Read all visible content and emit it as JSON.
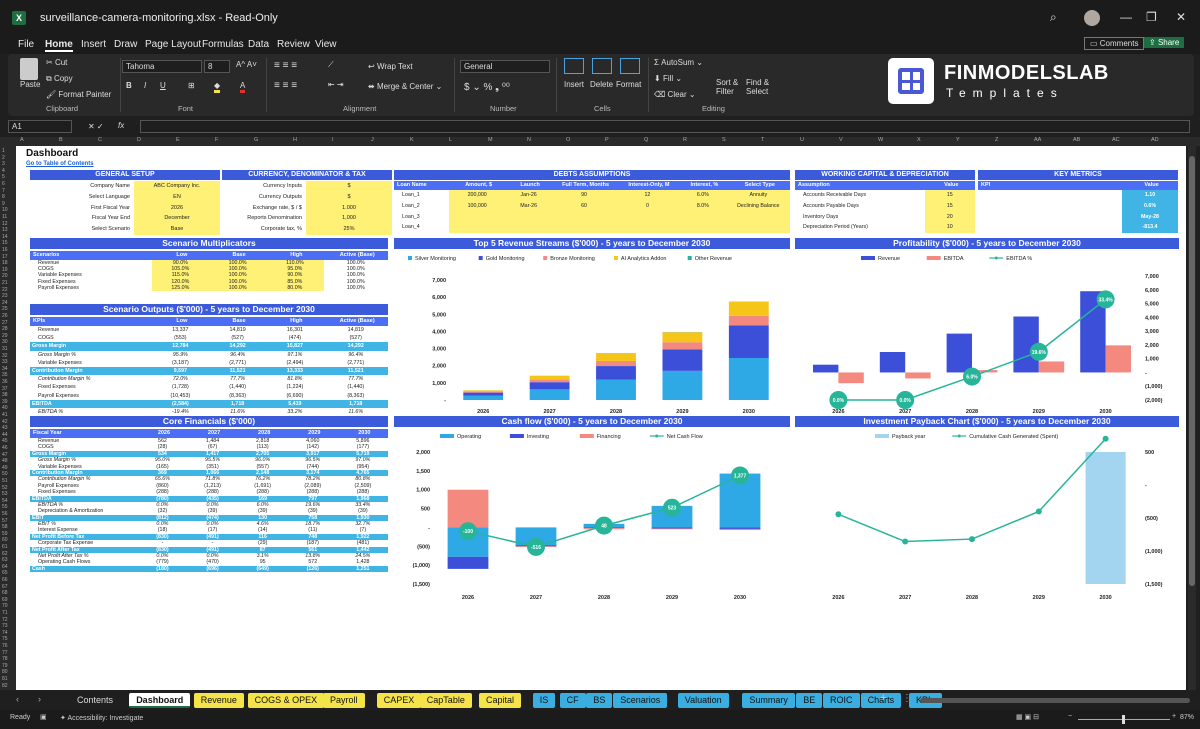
{
  "window": {
    "filename": "surveillance-camera-monitoring.xlsx",
    "mode": "Read-Only"
  },
  "menu": [
    "File",
    "Home",
    "Insert",
    "Draw",
    "Page Layout",
    "Formulas",
    "Data",
    "Review",
    "View"
  ],
  "topright": {
    "comments": "Comments",
    "share": "Share"
  },
  "ribbon": {
    "clipboard": {
      "paste": "Paste",
      "cut": "Cut",
      "copy": "Copy",
      "format_painter": "Format Painter",
      "label": "Clipboard"
    },
    "font": {
      "name": "Tahoma",
      "size": "8",
      "label": "Font"
    },
    "alignment": {
      "wrap": "Wrap Text",
      "merge": "Merge & Center",
      "label": "Alignment"
    },
    "number": {
      "format": "General",
      "label": "Number"
    },
    "cells": {
      "insert": "Insert",
      "delete": "Delete",
      "format": "Format",
      "label": "Cells"
    },
    "editing": {
      "autosum": "AutoSum",
      "fill": "Fill",
      "clear": "Clear",
      "sort": "Sort & Filter",
      "find": "Find & Select",
      "label": "Editing"
    },
    "logo": {
      "title": "FINMODELSLAB",
      "sub": "Templates"
    }
  },
  "formula_bar": {
    "cell": "A1",
    "fx": "fx"
  },
  "dashboard": {
    "title": "Dashboard",
    "toc": "Go to Table of Contents",
    "general": {
      "header": "GENERAL SETUP",
      "rows": [
        [
          "Company Name",
          "ABC Company Inc."
        ],
        [
          "Select Language",
          "EN"
        ],
        [
          "First Fiscal Year",
          "2026"
        ],
        [
          "Fiscal Year End",
          "December"
        ],
        [
          "Select Scenario",
          "Base"
        ]
      ]
    },
    "currency": {
      "header": "CURRENCY, DENOMINATOR & TAX",
      "rows": [
        [
          "Currency Inputs",
          "$"
        ],
        [
          "Currency Outputs",
          "$"
        ],
        [
          "Exchange rate, $ / $",
          "1.000"
        ],
        [
          "Reports Denomination",
          "1,000"
        ],
        [
          "Corporate tax, %",
          "25%"
        ]
      ]
    },
    "debts": {
      "header": "DEBTS ASSUMPTIONS",
      "cols": [
        "Loan Name",
        "Amount, $",
        "Launch",
        "Full Term, Months",
        "Interest-Only, M",
        "Interest, %",
        "Select Type"
      ],
      "rows": [
        [
          "Loan_1",
          "200,000",
          "Jan-26",
          "90",
          "12",
          "6.0%",
          "Annuity"
        ],
        [
          "Loan_2",
          "100,000",
          "Mar-26",
          "60",
          "0",
          "8.0%",
          "Declining Balance"
        ],
        [
          "Loan_3",
          "",
          "",
          "",
          "",
          "",
          ""
        ],
        [
          "Loan_4",
          "",
          "",
          "",
          "",
          "",
          ""
        ]
      ]
    },
    "wc": {
      "header": "WORKING CAPITAL & DEPRECIATION",
      "cols": [
        "Assumption",
        "Value"
      ],
      "rows": [
        [
          "Accounts Receivable Days",
          "15"
        ],
        [
          "Accounts Payable Days",
          "15"
        ],
        [
          "Inventory Days",
          "20"
        ],
        [
          "Depreciation Period (Years)",
          "10"
        ]
      ]
    },
    "kpi": {
      "header": "KEY METRICS",
      "cols": [
        "KPI",
        "Value"
      ],
      "rows": [
        [
          "Return on Equity (ROE)",
          "1.10"
        ],
        [
          "Internal Rate of Return (IRR), %",
          "0.6%"
        ],
        [
          "Minimum Cash Month",
          "May-28"
        ],
        [
          "Minimum Cash ($'000)",
          "-813.4"
        ]
      ]
    },
    "scen_mult": {
      "header": "Scenario Multiplicators",
      "cols": [
        "Scenarios",
        "Low",
        "Base",
        "High",
        "Active (Base)"
      ],
      "rows": [
        [
          "Revenue",
          "90.0%",
          "100.0%",
          "110.0%",
          "100.0%"
        ],
        [
          "COGS",
          "105.0%",
          "100.0%",
          "95.0%",
          "100.0%"
        ],
        [
          "Variable Expenses",
          "115.0%",
          "100.0%",
          "90.0%",
          "100.0%"
        ],
        [
          "Fixed Expenses",
          "120.0%",
          "100.0%",
          "85.0%",
          "100.0%"
        ],
        [
          "Payroll Expenses",
          "125.0%",
          "100.0%",
          "80.0%",
          "100.0%"
        ]
      ]
    },
    "scen_out": {
      "header": "Scenario Outputs ($'000) - 5 years to December 2030",
      "cols": [
        "KPIs",
        "Low",
        "Base",
        "High",
        "Active (Base)"
      ],
      "rows": [
        [
          "Revenue",
          "13,337",
          "14,819",
          "16,301",
          "14,819"
        ],
        [
          "COGS",
          "(553)",
          "(527)",
          "(474)",
          "(527)"
        ],
        [
          "Gross Margin",
          "12,784",
          "14,292",
          "15,827",
          "14,292"
        ],
        [
          "Gross Margin %",
          "95.9%",
          "96.4%",
          "97.1%",
          "96.4%"
        ],
        [
          "Variable Expenses",
          "(3,187)",
          "(2,771)",
          "(2,494)",
          "(2,771)"
        ],
        [
          "Contribution Margin",
          "9,597",
          "11,521",
          "13,333",
          "11,521"
        ],
        [
          "Contribution Margin %",
          "72.0%",
          "77.7%",
          "81.8%",
          "77.7%"
        ],
        [
          "Fixed Expenses",
          "(1,728)",
          "(1,440)",
          "(1,224)",
          "(1,440)"
        ],
        [
          "Payroll Expenses",
          "(10,453)",
          "(8,363)",
          "(6,690)",
          "(8,363)"
        ],
        [
          "EBITDA",
          "(2,584)",
          "1,718",
          "5,419",
          "1,718"
        ],
        [
          "EBITDA %",
          "-19.4%",
          "11.6%",
          "33.2%",
          "11.6%"
        ]
      ]
    },
    "core": {
      "header": "Core Financials ($'000)",
      "cols": [
        "Fiscal Year",
        "2026",
        "2027",
        "2028",
        "2029",
        "2030"
      ],
      "rows": [
        [
          "Revenue",
          "562",
          "1,484",
          "2,818",
          "4,060",
          "5,896"
        ],
        [
          "COGS",
          "(28)",
          "(67)",
          "(113)",
          "(142)",
          "(177)"
        ],
        [
          "Gross Margin",
          "534",
          "1,417",
          "2,705",
          "3,917",
          "5,719"
        ],
        [
          "Gross Margin %",
          "95.0%",
          "95.5%",
          "96.0%",
          "96.5%",
          "97.0%"
        ],
        [
          "Variable Expenses",
          "(165)",
          "(351)",
          "(557)",
          "(744)",
          "(954)"
        ],
        [
          "Contribution Margin",
          "369",
          "1,066",
          "2,148",
          "3,174",
          "4,765"
        ],
        [
          "Contribution Margin %",
          "65.6%",
          "71.8%",
          "76.2%",
          "78.2%",
          "80.8%"
        ],
        [
          "Payroll Expenses",
          "(860)",
          "(1,213)",
          "(1,691)",
          "(2,089)",
          "(2,509)"
        ],
        [
          "Fixed Expenses",
          "(288)",
          "(288)",
          "(288)",
          "(288)",
          "(288)"
        ],
        [
          "EBITDA",
          "(780)",
          "(435)",
          "169",
          "797",
          "1,968"
        ],
        [
          "EBITDA %",
          "0.0%",
          "0.0%",
          "6.0%",
          "19.6%",
          "33.4%"
        ],
        [
          "Depreciation & Amortization",
          "(32)",
          "(39)",
          "(39)",
          "(39)",
          "(39)"
        ],
        [
          "EBIT",
          "(812)",
          "(474)",
          "130",
          "758",
          "1,930"
        ],
        [
          "EBIT %",
          "0.0%",
          "0.0%",
          "4.6%",
          "18.7%",
          "32.7%"
        ],
        [
          "Interest Expense",
          "(18)",
          "(17)",
          "(14)",
          "(11)",
          "(7)"
        ],
        [
          "Net Profit Before Tax",
          "(830)",
          "(491)",
          "116",
          "748",
          "1,922"
        ],
        [
          "Corporate Tax Expense",
          "-",
          "-",
          "(29)",
          "(187)",
          "(481)"
        ],
        [
          "Net Profit After Tax",
          "(830)",
          "(491)",
          "87",
          "561",
          "1,442"
        ],
        [
          "Net Profit After Tax %",
          "0.0%",
          "0.0%",
          "3.1%",
          "13.8%",
          "24.5%"
        ],
        [
          "Operating Cash Flows",
          "(779)",
          "(470)",
          "95",
          "572",
          "1,428"
        ],
        [
          "Cash",
          "(180)",
          "(696)",
          "(649)",
          "(126)",
          "1,251"
        ]
      ]
    }
  },
  "chart_data": [
    {
      "type": "bar",
      "title": "Top 5 Revenue Streams ($'000) - 5 years to December 2030",
      "categories": [
        "2026",
        "2027",
        "2028",
        "2029",
        "2030"
      ],
      "stacked": true,
      "ylim": [
        0,
        7000
      ],
      "yticks": [
        "-",
        "1,000",
        "2,000",
        "3,000",
        "4,000",
        "5,000",
        "6,000",
        "7,000"
      ],
      "series": [
        {
          "name": "Silver Monitoring",
          "color": "#2fa8e6",
          "values": [
            250,
            620,
            1180,
            1700,
            2450
          ]
        },
        {
          "name": "Gold Monitoring",
          "color": "#3b4fd8",
          "values": [
            180,
            420,
            800,
            1250,
            1900
          ]
        },
        {
          "name": "Bronze Monitoring",
          "color": "#f4897f",
          "values": [
            60,
            150,
            300,
            420,
            560
          ]
        },
        {
          "name": "AI Analytics Addon",
          "color": "#f5c518",
          "values": [
            70,
            220,
            450,
            580,
            820
          ]
        },
        {
          "name": "Other Revenue",
          "color": "#27b59a",
          "values": [
            2,
            5,
            8,
            10,
            12
          ]
        }
      ]
    },
    {
      "type": "bar",
      "title": "Profitability ($'000) - 5 years to December 2030",
      "categories": [
        "2026",
        "2027",
        "2028",
        "2029",
        "2030"
      ],
      "ylim": [
        -2000,
        7000
      ],
      "yticks": [
        "(2,000)",
        "(1,000)",
        "-",
        "1,000",
        "2,000",
        "3,000",
        "4,000",
        "5,000",
        "6,000",
        "7,000"
      ],
      "series": [
        {
          "name": "Revenue",
          "color": "#3b4fd8",
          "values": [
            562,
            1484,
            2818,
            4060,
            5896
          ]
        },
        {
          "name": "EBITDA",
          "color": "#f4897f",
          "values": [
            -780,
            -435,
            169,
            797,
            1968
          ]
        },
        {
          "name": "EBITDA %",
          "color": "#27b59a",
          "line": true,
          "labels": [
            "0.0%",
            "0.0%",
            "6.0%",
            "19.6%",
            "33.4%"
          ],
          "values": [
            -2000,
            -2000,
            -300,
            1500,
            5300
          ]
        }
      ]
    },
    {
      "type": "bar",
      "title": "Cash flow ($'000) - 5 years to December 2030",
      "categories": [
        "2026",
        "2027",
        "2028",
        "2029",
        "2030"
      ],
      "ylim": [
        -1500,
        2000
      ],
      "yticks": [
        "(1,500)",
        "(1,000)",
        "(500)",
        "-",
        "500",
        "1,000",
        "1,500",
        "2,000"
      ],
      "series": [
        {
          "name": "Operating",
          "color": "#2fa8e6",
          "values": [
            -779,
            -470,
            95,
            572,
            1428
          ]
        },
        {
          "name": "Investing",
          "color": "#3b4fd8",
          "values": [
            -320,
            -30,
            -20,
            -30,
            -40
          ]
        },
        {
          "name": "Financing",
          "color": "#f4897f",
          "values": [
            1000,
            -20,
            -30,
            -20,
            -30
          ]
        },
        {
          "name": "Net Cash Flow",
          "color": "#27b59a",
          "line": true,
          "labels": [
            "-100",
            "-516",
            "48",
            "523",
            "1,377"
          ],
          "values": [
            -100,
            -516,
            48,
            523,
            1377
          ]
        }
      ]
    },
    {
      "type": "bar",
      "title": "Investment Payback Chart ($'000) - 5 years to December 2030",
      "categories": [
        "2026",
        "2027",
        "2028",
        "2029",
        "2030"
      ],
      "ylim": [
        -1500,
        1000
      ],
      "yticks": [
        "(1,500)",
        "(1,000)",
        "(500)",
        "-",
        "500"
      ],
      "series": [
        {
          "name": "Payback year",
          "color": "#a3d4f0",
          "values": [
            0,
            0,
            0,
            0,
            1
          ]
        },
        {
          "name": "Cumulative Cash Generated (Spent)",
          "color": "#27b59a",
          "line": true,
          "values": [
            -180,
            -696,
            -649,
            -126,
            1251
          ]
        }
      ]
    }
  ],
  "tabs": [
    [
      "Contents",
      "#1f1f1f"
    ],
    [
      "Dashboard",
      "#fff"
    ],
    [
      "Revenue",
      "#f5e34a"
    ],
    [
      "COGS & OPEX",
      "#f5e34a"
    ],
    [
      "Payroll",
      "#f5e34a"
    ],
    [
      "CAPEX",
      "#f5e34a"
    ],
    [
      "CapTable",
      "#f5e34a"
    ],
    [
      "Capital",
      "#f5e34a"
    ],
    [
      "IS",
      "#3aaee0"
    ],
    [
      "CF",
      "#3aaee0"
    ],
    [
      "BS",
      "#3aaee0"
    ],
    [
      "Scenarios",
      "#3aaee0"
    ],
    [
      "Valuation",
      "#3aaee0"
    ],
    [
      "Summary",
      "#3aaee0"
    ],
    [
      "BE",
      "#3aaee0"
    ],
    [
      "ROIC",
      "#3aaee0"
    ],
    [
      "Charts",
      "#3aaee0"
    ],
    [
      "KPIs",
      "#3aaee0"
    ]
  ],
  "status": {
    "ready": "Ready",
    "access": "Accessibility: Investigate",
    "zoom": "87%"
  }
}
